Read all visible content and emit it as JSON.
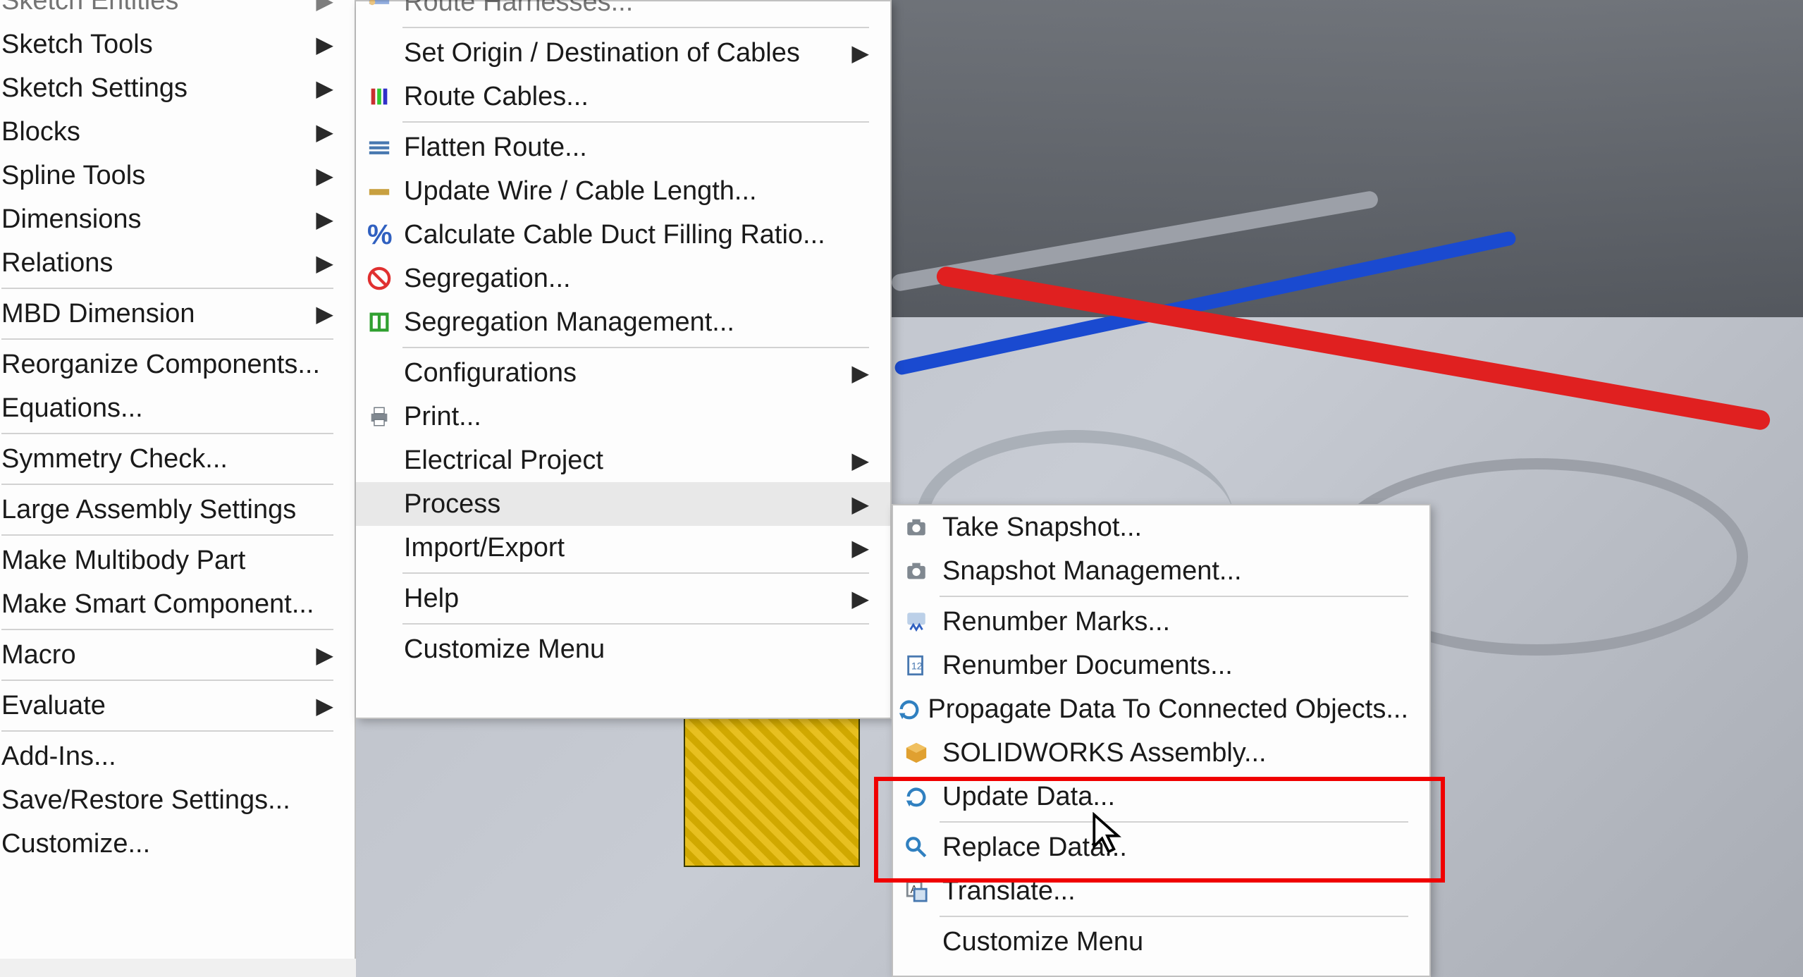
{
  "menu1": {
    "sketch_entities": "Sketch Entities",
    "sketch_tools": "Sketch Tools",
    "sketch_settings": "Sketch Settings",
    "blocks": "Blocks",
    "spline_tools": "Spline Tools",
    "dimensions": "Dimensions",
    "relations": "Relations",
    "mbd_dimension": "MBD Dimension",
    "reorganize_components": "Reorganize Components...",
    "equations": "Equations...",
    "symmetry_check": "Symmetry Check...",
    "large_assembly": "Large Assembly Settings",
    "make_multibody": "Make Multibody Part",
    "make_smart": "Make Smart Component...",
    "macro": "Macro",
    "evaluate": "Evaluate",
    "add_ins": "Add-Ins...",
    "save_restore": "Save/Restore Settings...",
    "customize": "Customize..."
  },
  "menu2": {
    "route_harnesses": "Route Harnesses...",
    "set_origin": "Set Origin / Destination of Cables",
    "route_cables": "Route Cables...",
    "flatten_route": "Flatten Route...",
    "update_wire": "Update Wire / Cable Length...",
    "calc_duct": "Calculate Cable Duct Filling Ratio...",
    "segregation": "Segregation...",
    "segregation_mgmt": "Segregation Management...",
    "configurations": "Configurations",
    "print": "Print...",
    "electrical_project": "Electrical Project",
    "process": "Process",
    "import_export": "Import/Export",
    "help": "Help",
    "customize_menu": "Customize Menu"
  },
  "menu3": {
    "take_snapshot": "Take Snapshot...",
    "snapshot_mgmt": "Snapshot Management...",
    "renumber_marks": "Renumber Marks...",
    "renumber_docs": "Renumber Documents...",
    "propagate_data": "Propagate Data To Connected Objects...",
    "solidworks_assembly": "SOLIDWORKS Assembly...",
    "update_data": "Update Data...",
    "replace_data": "Replace Data...",
    "translate": "Translate...",
    "customize_menu": "Customize Menu"
  },
  "icons": {
    "camera": "camera",
    "arrow_right": "▶"
  }
}
